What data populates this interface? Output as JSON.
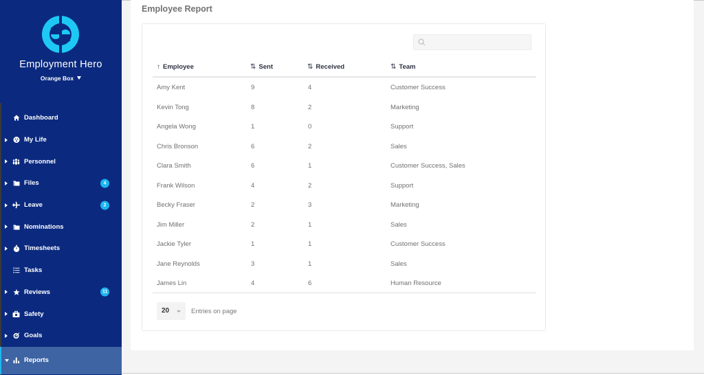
{
  "app": {
    "brand": "Employment Hero",
    "organization": "Orange Box",
    "accent_color": "#1bb5f0",
    "sidebar_color": "#0b2a7f",
    "active_color": "#3e64a3"
  },
  "sidebar": {
    "items": [
      {
        "label": "Dashboard",
        "icon": "home-icon",
        "expandable": false,
        "badge": null
      },
      {
        "label": "My Life",
        "icon": "smiley-icon",
        "expandable": true,
        "badge": null
      },
      {
        "label": "Personnel",
        "icon": "people-icon",
        "expandable": true,
        "badge": null
      },
      {
        "label": "Files",
        "icon": "folder-icon",
        "expandable": true,
        "badge": "4"
      },
      {
        "label": "Leave",
        "icon": "plane-icon",
        "expandable": true,
        "badge": "2"
      },
      {
        "label": "Nominations",
        "icon": "folder-icon",
        "expandable": true,
        "badge": null
      },
      {
        "label": "Timesheets",
        "icon": "stopwatch-icon",
        "expandable": true,
        "badge": null
      },
      {
        "label": "Tasks",
        "icon": "list-icon",
        "expandable": false,
        "badge": null
      },
      {
        "label": "Reviews",
        "icon": "star-icon",
        "expandable": true,
        "badge": "11"
      },
      {
        "label": "Safety",
        "icon": "first-aid-icon",
        "expandable": true,
        "badge": null
      },
      {
        "label": "Goals",
        "icon": "target-icon",
        "expandable": true,
        "badge": null
      },
      {
        "label": "Reports",
        "icon": "bar-chart-icon",
        "expandable": true,
        "badge": null,
        "active": true
      }
    ]
  },
  "main": {
    "title": "Employee Report",
    "search": {
      "value": "",
      "placeholder": ""
    },
    "table": {
      "columns": [
        {
          "label": "Employee",
          "sort": "↑"
        },
        {
          "label": "Sent",
          "sort": "⇅"
        },
        {
          "label": "Received",
          "sort": "⇅"
        },
        {
          "label": "Team",
          "sort": "⇅"
        }
      ],
      "rows": [
        {
          "employee": "Amy Kent",
          "sent": "9",
          "received": "4",
          "team": "Customer Success"
        },
        {
          "employee": "Kevin Tong",
          "sent": "8",
          "received": "2",
          "team": "Marketing"
        },
        {
          "employee": "Angela Wong",
          "sent": "1",
          "received": "0",
          "team": "Support"
        },
        {
          "employee": "Chris Bronson",
          "sent": "6",
          "received": "2",
          "team": "Sales"
        },
        {
          "employee": "Clara Smith",
          "sent": "6",
          "received": "1",
          "team": "Customer Success, Sales"
        },
        {
          "employee": "Frank Wilson",
          "sent": "4",
          "received": "2",
          "team": "Support"
        },
        {
          "employee": "Becky Fraser",
          "sent": "2",
          "received": "3",
          "team": "Marketing"
        },
        {
          "employee": "Jim Miller",
          "sent": "2",
          "received": "1",
          "team": "Sales"
        },
        {
          "employee": "Jackie Tyler",
          "sent": "1",
          "received": "1",
          "team": "Customer Success"
        },
        {
          "employee": "Jane Reynolds",
          "sent": "3",
          "received": "1",
          "team": "Sales"
        },
        {
          "employee": "James Lin",
          "sent": "4",
          "received": "6",
          "team": "Human Resource"
        }
      ]
    },
    "pagination": {
      "page_size": "20",
      "label": "Entries on page"
    }
  }
}
